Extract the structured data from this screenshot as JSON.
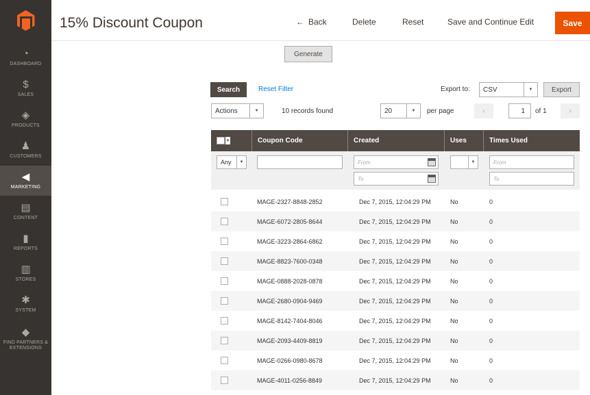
{
  "sidebar": {
    "items": [
      {
        "label": "DASHBOARD",
        "icon": "dashboard-icon",
        "glyph": "◔"
      },
      {
        "label": "SALES",
        "icon": "dollar-icon",
        "glyph": "$"
      },
      {
        "label": "PRODUCTS",
        "icon": "cube-icon",
        "glyph": "◈"
      },
      {
        "label": "CUSTOMERS",
        "icon": "person-icon",
        "glyph": "♟"
      },
      {
        "label": "MARKETING",
        "icon": "megaphone-icon",
        "glyph": "◀"
      },
      {
        "label": "CONTENT",
        "icon": "layout-icon",
        "glyph": "▤"
      },
      {
        "label": "REPORTS",
        "icon": "bar-chart-icon",
        "glyph": "▮"
      },
      {
        "label": "STORES",
        "icon": "store-icon",
        "glyph": "▥"
      },
      {
        "label": "SYSTEM",
        "icon": "gear-icon",
        "glyph": "✱"
      },
      {
        "label": "FIND PARTNERS & EXTENSIONS",
        "icon": "puzzle-icon",
        "glyph": "◆"
      }
    ],
    "active_index": 4
  },
  "header": {
    "title": "15% Discount Coupon",
    "back_label": "Back",
    "delete_label": "Delete",
    "reset_label": "Reset",
    "save_continue_label": "Save and Continue Edit",
    "save_label": "Save"
  },
  "generate_label": "Generate",
  "toolbar": {
    "search_label": "Search",
    "reset_filter_label": "Reset Filter",
    "export_to_label": "Export to:",
    "export_format": "CSV",
    "export_label": "Export",
    "actions_label": "Actions",
    "records_found": "10 records found",
    "per_page_value": "20",
    "per_page_label": "per page",
    "current_page": "1",
    "of_label": "of 1"
  },
  "grid": {
    "columns": [
      "Coupon Code",
      "Created",
      "Uses",
      "Times Used"
    ],
    "filters": {
      "any_label": "Any",
      "from_placeholder": "From",
      "to_placeholder": "To"
    },
    "rows": [
      {
        "code": "MAGE-2327-8848-2852",
        "created": "Dec 7, 2015, 12:04:29 PM",
        "uses": "No",
        "times_used": "0"
      },
      {
        "code": "MAGE-6072-2805-8644",
        "created": "Dec 7, 2015, 12:04:29 PM",
        "uses": "No",
        "times_used": "0"
      },
      {
        "code": "MAGE-3223-2864-6862",
        "created": "Dec 7, 2015, 12:04:29 PM",
        "uses": "No",
        "times_used": "0"
      },
      {
        "code": "MAGE-8823-7600-0348",
        "created": "Dec 7, 2015, 12:04:29 PM",
        "uses": "No",
        "times_used": "0"
      },
      {
        "code": "MAGE-0888-2028-0878",
        "created": "Dec 7, 2015, 12:04:29 PM",
        "uses": "No",
        "times_used": "0"
      },
      {
        "code": "MAGE-2680-0904-9469",
        "created": "Dec 7, 2015, 12:04:29 PM",
        "uses": "No",
        "times_used": "0"
      },
      {
        "code": "MAGE-8142-7404-8046",
        "created": "Dec 7, 2015, 12:04:29 PM",
        "uses": "No",
        "times_used": "0"
      },
      {
        "code": "MAGE-2093-4409-8819",
        "created": "Dec 7, 2015, 12:04:29 PM",
        "uses": "No",
        "times_used": "0"
      },
      {
        "code": "MAGE-0266-0980-8678",
        "created": "Dec 7, 2015, 12:04:29 PM",
        "uses": "No",
        "times_used": "0"
      },
      {
        "code": "MAGE-4011-0256-8849",
        "created": "Dec 7, 2015, 12:04:29 PM",
        "uses": "No",
        "times_used": "0"
      }
    ]
  },
  "colors": {
    "sidebar_bg": "#373330",
    "accent": "#eb5202",
    "logo": "#f26322",
    "grid_header": "#514943",
    "link": "#007bdb"
  }
}
